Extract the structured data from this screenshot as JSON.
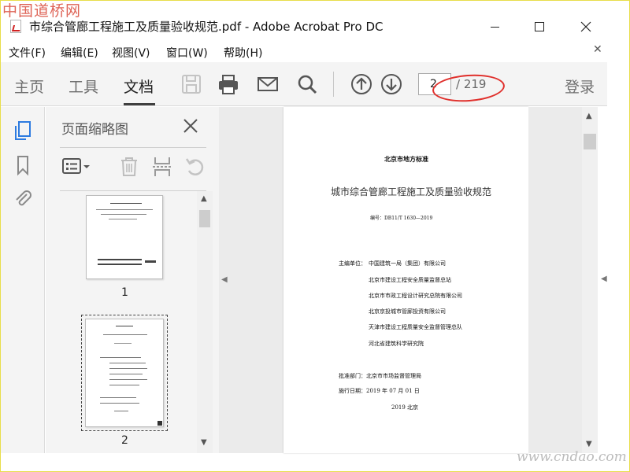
{
  "watermark_top": "中国道桥网",
  "watermark_bottom": "www.cndao.com",
  "window": {
    "title": "市综合管廊工程施工及质量验收规范.pdf - Adobe Acrobat Pro DC"
  },
  "menu": [
    {
      "label": "文件(F)"
    },
    {
      "label": "编辑(E)"
    },
    {
      "label": "视图(V)"
    },
    {
      "label": "窗口(W)"
    },
    {
      "label": "帮助(H)"
    }
  ],
  "toolbar": {
    "tabs": [
      {
        "label": "主页"
      },
      {
        "label": "工具"
      },
      {
        "label": "文档"
      }
    ],
    "active_tab": "文档",
    "icons": [
      "save-icon",
      "print-icon",
      "email-icon",
      "search-icon",
      "prev-page-icon",
      "next-page-icon"
    ],
    "page_input": "2",
    "page_total": "/ 219",
    "login": "登录"
  },
  "panel": {
    "title": "页面缩略图",
    "thumbnails": [
      {
        "num": "1"
      },
      {
        "num": "2"
      }
    ]
  },
  "document": {
    "header": "北京市地方标准",
    "title": "城市综合管廊工程施工及质量验收规范",
    "code": "编号：DB11/T 1630—2019",
    "editor_label": "主编单位：",
    "orgs": [
      "中国建筑一局（集团）有限公司",
      "北京市建设工程安全质量监督总站",
      "北京市市政工程设计研究总院有限公司",
      "北京京投城市管廊投资有限公司",
      "天津市建设工程质量安全监督管理总队",
      "河北省建筑科学研究院"
    ],
    "approve": "批准部门：北京市市场监督管理局",
    "implement": "施行日期：2019 年 07 月 01 日",
    "footer": "2019  北京"
  },
  "colors": {
    "accent": "#2d7be0",
    "annotation": "#e0302c"
  }
}
